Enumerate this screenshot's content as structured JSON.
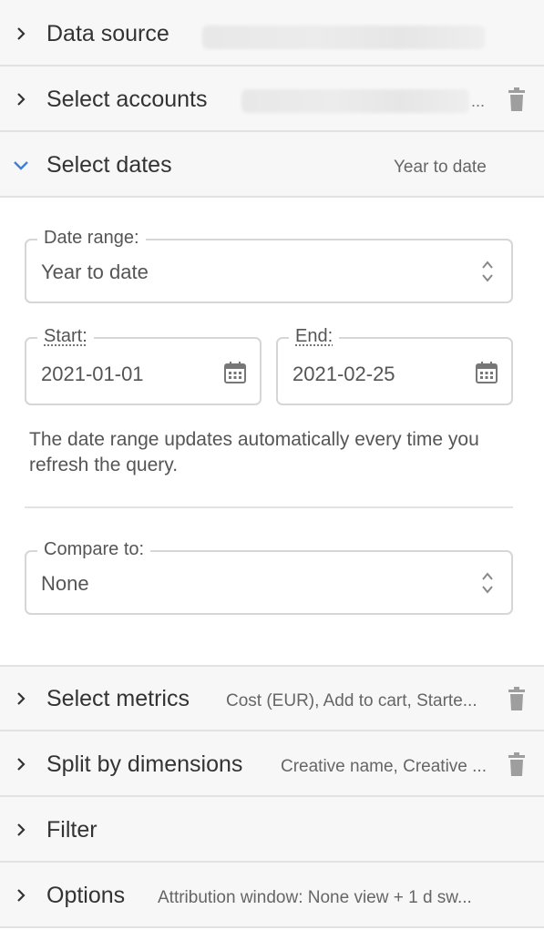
{
  "sections": {
    "data_source": {
      "title": "Data source"
    },
    "select_accounts": {
      "title": "Select accounts",
      "ellipsis": "..."
    },
    "select_dates": {
      "title": "Select dates",
      "summary": "Year to date"
    },
    "select_metrics": {
      "title": "Select metrics",
      "summary": "Cost (EUR), Add to cart, Starte..."
    },
    "split_by_dimensions": {
      "title": "Split by dimensions",
      "summary": "Creative name, Creative ..."
    },
    "filter": {
      "title": "Filter"
    },
    "options": {
      "title": "Options",
      "summary": "Attribution window: None view + 1 d sw..."
    }
  },
  "dates_panel": {
    "date_range": {
      "label": "Date range:",
      "value": "Year to date"
    },
    "start": {
      "label": "Start:",
      "value": "2021-01-01"
    },
    "end": {
      "label": "End:",
      "value": "2021-02-25"
    },
    "help_text": "The date range updates automatically every time you refresh the query.",
    "compare_to": {
      "label": "Compare to:",
      "value": "None"
    }
  },
  "colors": {
    "accent": "#3f7fd8",
    "icon": "#9e9e9e",
    "divider": "#e2e2e2"
  },
  "icons": [
    "chevron-right-icon",
    "chevron-down-icon",
    "trash-icon",
    "calendar-icon",
    "up-down-arrows-icon"
  ]
}
